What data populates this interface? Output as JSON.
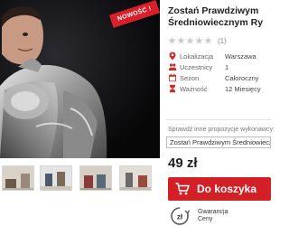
{
  "product": {
    "badge": "NOWOŚĆ !",
    "title_line1": "Zostań Prawdziwym",
    "title_line2": "Średniowiecznym Ry",
    "rating_count": "(1)",
    "stars_filled": 0,
    "stars_total": 5
  },
  "details": [
    {
      "icon": "location-pin-icon",
      "label": "Lokalizacja",
      "value": "Warszawa"
    },
    {
      "icon": "people-icon",
      "label": "Uczestnicy",
      "value": "1"
    },
    {
      "icon": "calendar-icon",
      "label": "Sezon",
      "value": "Całoroczny"
    },
    {
      "icon": "hourglass-icon",
      "label": "Ważność",
      "value": "12 Miesięcy"
    }
  ],
  "other_offers": {
    "label": "Sprawdź inne propozycje wykonawcy:",
    "selected": "Zostań Prawdziwym Średniowieczn"
  },
  "price": "49 zł",
  "cart": {
    "label": "Do koszyka",
    "color": "#d32027"
  },
  "guarantee": {
    "line1": "Gwarancja",
    "line2": "Ceny",
    "icon_text": "zł"
  },
  "colors": {
    "accent": "#d32027",
    "badge": "#d8202a",
    "icon_red": "#c9302c"
  }
}
